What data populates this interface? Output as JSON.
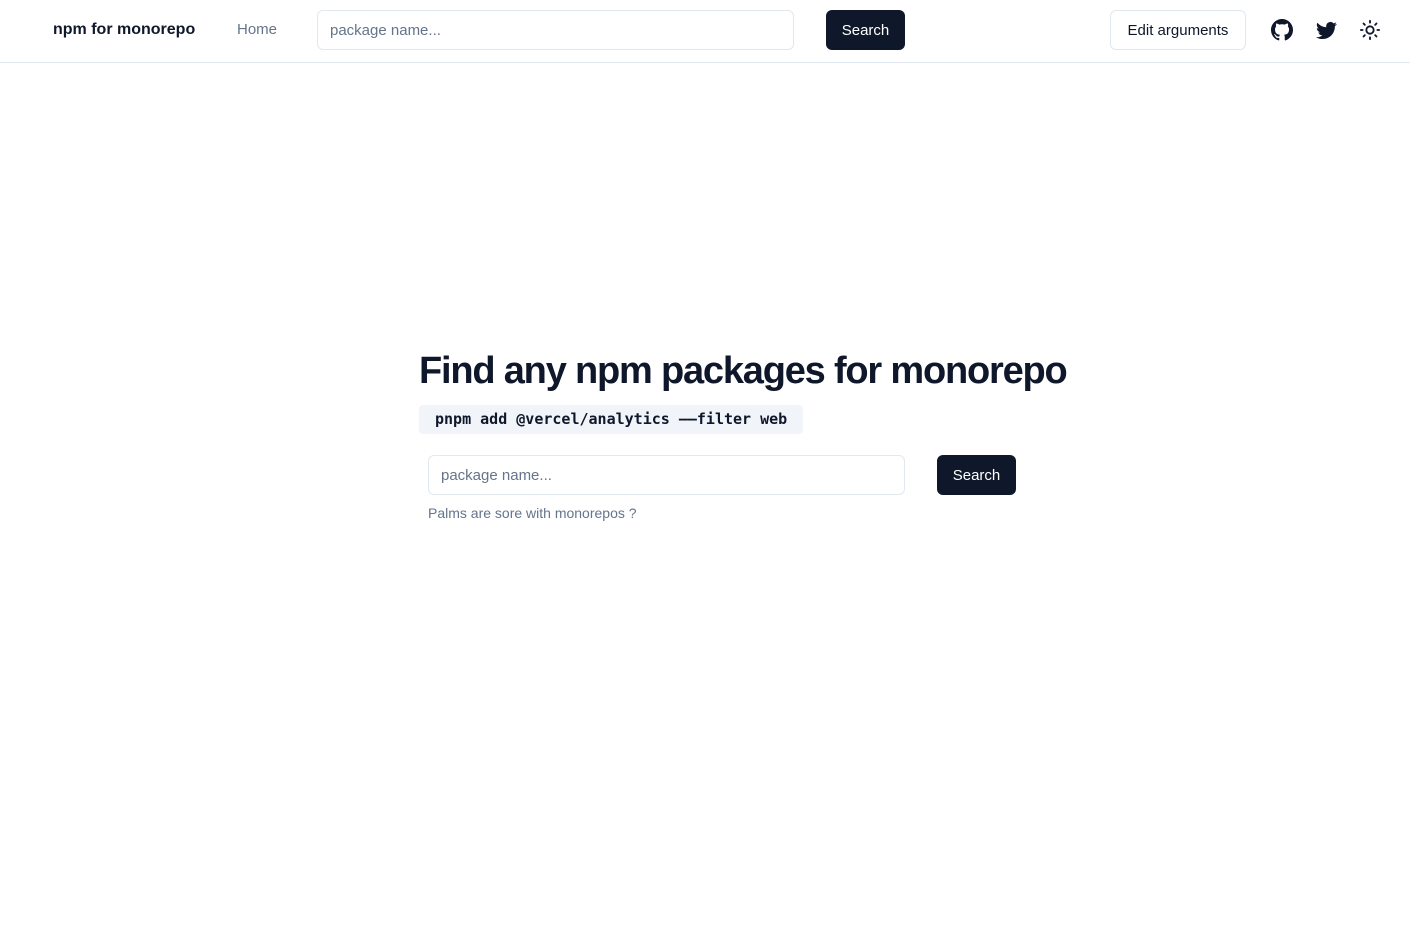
{
  "header": {
    "brand": "npm for monorepo",
    "nav_home": "Home",
    "search_placeholder": "package name...",
    "search_value": "",
    "search_button": "Search",
    "edit_arguments": "Edit arguments",
    "icons": [
      "github-icon",
      "twitter-icon",
      "sun-icon"
    ]
  },
  "hero": {
    "title": "Find any npm packages for monorepo",
    "command": "pnpm add @vercel/analytics ——filter web",
    "search_placeholder": "package name...",
    "search_value": "",
    "search_button": "Search",
    "hint": "Palms are sore with monorepos ?"
  },
  "colors": {
    "primary": "#0f172a",
    "muted_text": "#64748b",
    "border": "#e2e8f0",
    "code_bg": "#f1f5f9",
    "background": "#ffffff"
  }
}
